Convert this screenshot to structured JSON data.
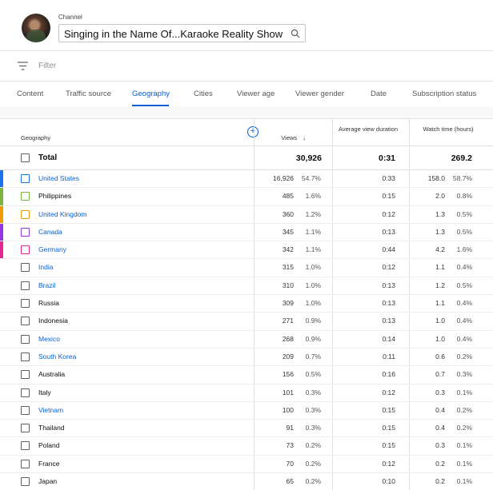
{
  "header": {
    "channel_label": "Channel",
    "channel_name": "Singing in the Name Of...Karaoke Reality Show"
  },
  "filter": {
    "placeholder": "Filter"
  },
  "tabs": [
    {
      "label": "Content",
      "active": false
    },
    {
      "label": "Traffic source",
      "active": false
    },
    {
      "label": "Geography",
      "active": true
    },
    {
      "label": "Cities",
      "active": false
    },
    {
      "label": "Viewer age",
      "active": false
    },
    {
      "label": "Viewer gender",
      "active": false
    },
    {
      "label": "Date",
      "active": false
    },
    {
      "label": "Subscription status",
      "active": false
    }
  ],
  "table": {
    "col_geography": "Geography",
    "col_views": "Views",
    "col_avd": "Average view duration",
    "col_watch": "Watch time (hours)",
    "total": {
      "label": "Total",
      "views": "30,926",
      "avd": "0:31",
      "watch": "269.2"
    },
    "rows": [
      {
        "name": "United States",
        "views": "16,926",
        "views_pct": "54.7%",
        "avd": "0:33",
        "watch": "158.0",
        "watch_pct": "58.7%",
        "link": true,
        "color": "#1a73e8",
        "checkbox_color": "#1a73e8"
      },
      {
        "name": "Philippines",
        "views": "485",
        "views_pct": "1.6%",
        "avd": "0:15",
        "watch": "2.0",
        "watch_pct": "0.8%",
        "link": false,
        "color": "#7cb342",
        "checkbox_color": "#7cb342"
      },
      {
        "name": "United Kingdom",
        "views": "360",
        "views_pct": "1.2%",
        "avd": "0:12",
        "watch": "1.3",
        "watch_pct": "0.5%",
        "link": true,
        "color": "#f29900",
        "checkbox_color": "#f29900"
      },
      {
        "name": "Canada",
        "views": "345",
        "views_pct": "1.1%",
        "avd": "0:13",
        "watch": "1.3",
        "watch_pct": "0.5%",
        "link": true,
        "color": "#9334e6",
        "checkbox_color": "#9334e6"
      },
      {
        "name": "Germany",
        "views": "342",
        "views_pct": "1.1%",
        "avd": "0:44",
        "watch": "4.2",
        "watch_pct": "1.6%",
        "link": true,
        "color": "#e52592",
        "checkbox_color": "#e52592"
      },
      {
        "name": "India",
        "views": "315",
        "views_pct": "1.0%",
        "avd": "0:12",
        "watch": "1.1",
        "watch_pct": "0.4%",
        "link": true,
        "color": "",
        "checkbox_color": ""
      },
      {
        "name": "Brazil",
        "views": "310",
        "views_pct": "1.0%",
        "avd": "0:13",
        "watch": "1.2",
        "watch_pct": "0.5%",
        "link": true,
        "color": "",
        "checkbox_color": ""
      },
      {
        "name": "Russia",
        "views": "309",
        "views_pct": "1.0%",
        "avd": "0:13",
        "watch": "1.1",
        "watch_pct": "0.4%",
        "link": false,
        "color": "",
        "checkbox_color": ""
      },
      {
        "name": "Indonesia",
        "views": "271",
        "views_pct": "0.9%",
        "avd": "0:13",
        "watch": "1.0",
        "watch_pct": "0.4%",
        "link": false,
        "color": "",
        "checkbox_color": ""
      },
      {
        "name": "Mexico",
        "views": "268",
        "views_pct": "0.9%",
        "avd": "0:14",
        "watch": "1.0",
        "watch_pct": "0.4%",
        "link": true,
        "color": "",
        "checkbox_color": ""
      },
      {
        "name": "South Korea",
        "views": "209",
        "views_pct": "0.7%",
        "avd": "0:11",
        "watch": "0.6",
        "watch_pct": "0.2%",
        "link": true,
        "color": "",
        "checkbox_color": ""
      },
      {
        "name": "Australia",
        "views": "156",
        "views_pct": "0.5%",
        "avd": "0:16",
        "watch": "0.7",
        "watch_pct": "0.3%",
        "link": false,
        "color": "",
        "checkbox_color": ""
      },
      {
        "name": "Italy",
        "views": "101",
        "views_pct": "0.3%",
        "avd": "0:12",
        "watch": "0.3",
        "watch_pct": "0.1%",
        "link": false,
        "color": "",
        "checkbox_color": ""
      },
      {
        "name": "Vietnam",
        "views": "100",
        "views_pct": "0.3%",
        "avd": "0:15",
        "watch": "0.4",
        "watch_pct": "0.2%",
        "link": true,
        "color": "",
        "checkbox_color": ""
      },
      {
        "name": "Thailand",
        "views": "91",
        "views_pct": "0.3%",
        "avd": "0:15",
        "watch": "0.4",
        "watch_pct": "0.2%",
        "link": false,
        "color": "",
        "checkbox_color": ""
      },
      {
        "name": "Poland",
        "views": "73",
        "views_pct": "0.2%",
        "avd": "0:15",
        "watch": "0.3",
        "watch_pct": "0.1%",
        "link": false,
        "color": "",
        "checkbox_color": ""
      },
      {
        "name": "France",
        "views": "70",
        "views_pct": "0.2%",
        "avd": "0:12",
        "watch": "0.2",
        "watch_pct": "0.1%",
        "link": false,
        "color": "",
        "checkbox_color": ""
      },
      {
        "name": "Japan",
        "views": "65",
        "views_pct": "0.2%",
        "avd": "0:10",
        "watch": "0.2",
        "watch_pct": "0.1%",
        "link": false,
        "color": "",
        "checkbox_color": ""
      }
    ]
  },
  "icons": {
    "search": "search-icon",
    "filter": "filter-icon",
    "add_column": "add-column-icon",
    "sort": "sort-down-arrow-icon"
  }
}
